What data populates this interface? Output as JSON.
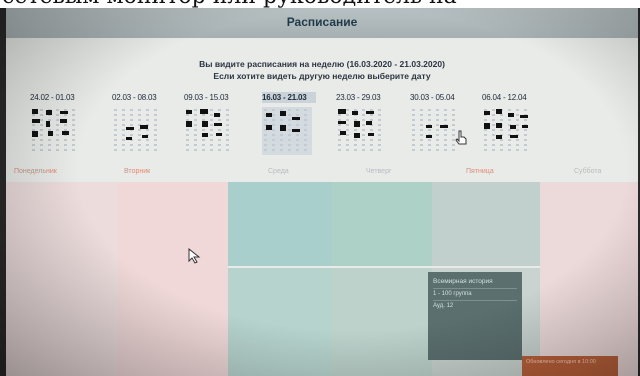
{
  "caption_cropped": "сетевым монитор или руководитель на",
  "window": {
    "title": "Расписание"
  },
  "intro": {
    "line1": "Вы видите расписания на неделю (16.03.2020 - 21.03.2020)",
    "line2": "Если хотите видеть другую неделю выберите дату"
  },
  "weeks": [
    {
      "label": "24.02 - 01.03",
      "active": false
    },
    {
      "label": "02.03 - 08.03",
      "active": false
    },
    {
      "label": "09.03 - 15.03",
      "active": false
    },
    {
      "label": "16.03 - 21.03",
      "active": true
    },
    {
      "label": "23.03 - 29.03",
      "active": false
    },
    {
      "label": "30.03 - 05.04",
      "active": false
    },
    {
      "label": "06.04 - 12.04",
      "active": false
    }
  ],
  "days": [
    "Понедельник",
    "Вторник",
    "Среда",
    "Четверг",
    "Пятница",
    "Суббота"
  ],
  "course": {
    "name": "Всемирная история",
    "group": "1 - 100 группа",
    "room": "Ауд. 12"
  },
  "corner_note": "Обновлено сегодня в 10:00",
  "colors": {
    "pink": "#efdcdc",
    "teal": "#a9cfcc",
    "grey_green": "#bfcfcb",
    "course_bg": "#5b6f6f",
    "accent_orange": "#b9603a"
  }
}
